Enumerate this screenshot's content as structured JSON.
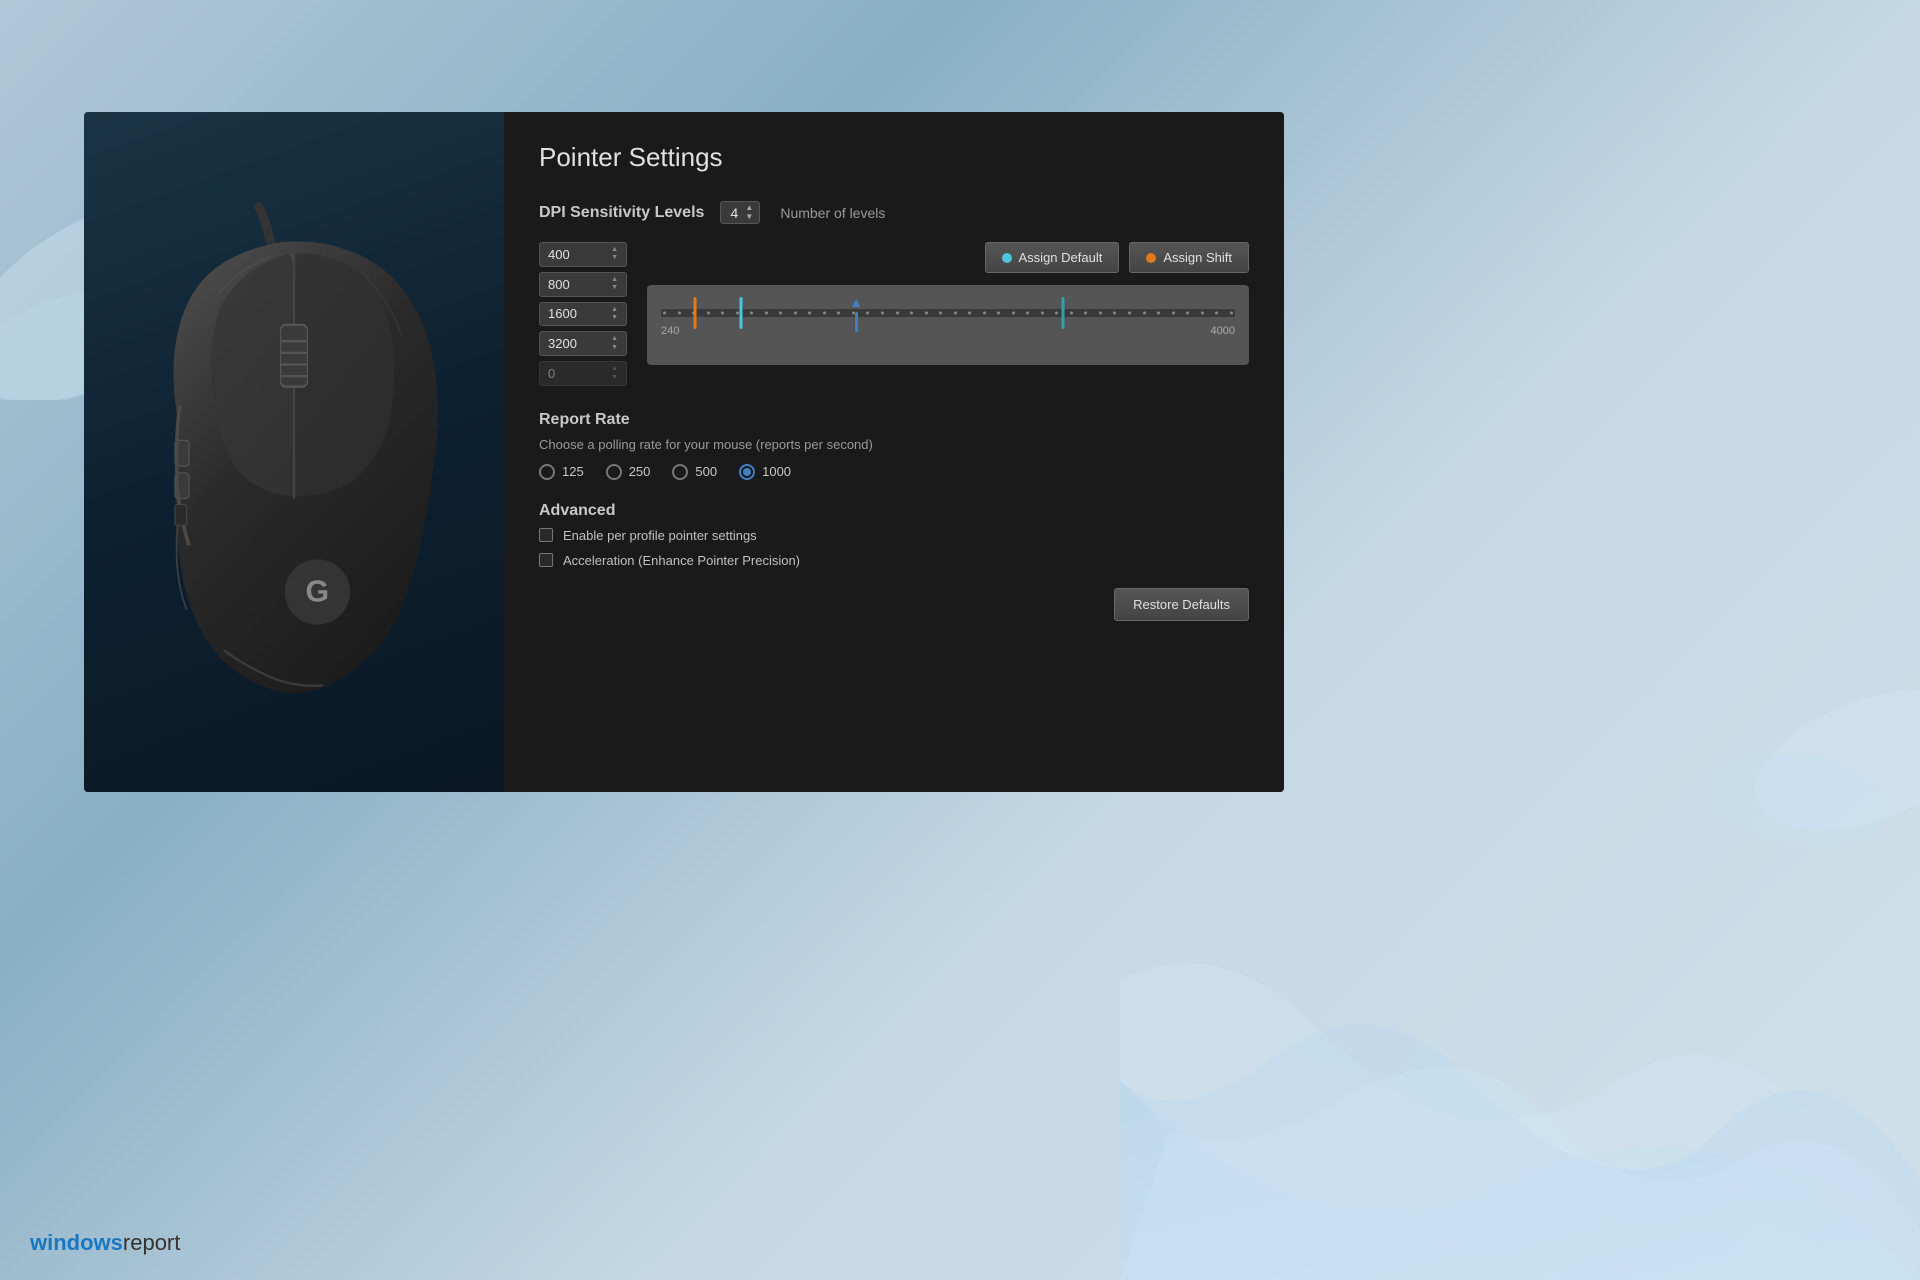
{
  "background": {
    "color_top": "#b0c8d8",
    "color_bottom": "#c5d8e4"
  },
  "branding": {
    "windows_text": "windows",
    "report_text": "report"
  },
  "panel": {
    "title": "Pointer Settings"
  },
  "dpi_section": {
    "label": "DPI Sensitivity Levels",
    "num_levels_value": "4",
    "num_levels_text": "Number of levels",
    "rows": [
      {
        "value": "400",
        "active": true
      },
      {
        "value": "800",
        "active": true
      },
      {
        "value": "1600",
        "active": true
      },
      {
        "value": "3200",
        "active": true
      },
      {
        "value": "0",
        "active": false
      }
    ],
    "assign_default_label": "Assign Default",
    "assign_shift_label": "Assign Shift",
    "slider_min": "240",
    "slider_max": "4000",
    "markers": [
      {
        "position_pct": 6,
        "color": "orange"
      },
      {
        "position_pct": 14,
        "color": "cyan"
      },
      {
        "position_pct": 34,
        "color": "blue-arrow"
      },
      {
        "position_pct": 70,
        "color": "teal"
      }
    ]
  },
  "report_rate": {
    "section_title": "Report Rate",
    "description": "Choose a polling rate for your mouse (reports per second)",
    "options": [
      {
        "value": "125",
        "selected": false
      },
      {
        "value": "250",
        "selected": false
      },
      {
        "value": "500",
        "selected": false
      },
      {
        "value": "1000",
        "selected": true
      }
    ]
  },
  "advanced": {
    "section_title": "Advanced",
    "checkboxes": [
      {
        "label": "Enable per profile pointer settings",
        "checked": false
      },
      {
        "label": "Acceleration (Enhance Pointer Precision)",
        "checked": false
      }
    ],
    "restore_button": "Restore Defaults"
  }
}
